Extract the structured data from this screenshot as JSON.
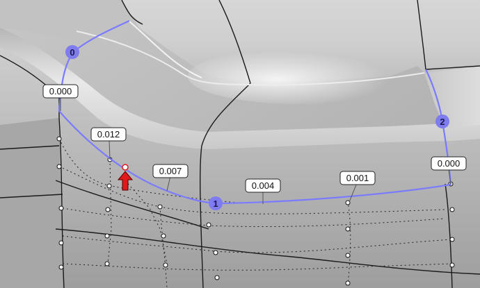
{
  "viewport": {
    "nodes": [
      {
        "label": "0"
      },
      {
        "label": "1"
      },
      {
        "label": "2"
      }
    ],
    "deviation_labels": [
      {
        "text": "0.000"
      },
      {
        "text": "0.012"
      },
      {
        "text": "0.007"
      },
      {
        "text": "0.004"
      },
      {
        "text": "0.001"
      },
      {
        "text": "0.000"
      }
    ],
    "colors": {
      "curve": "#7b7bff",
      "node": "#7f7cf0",
      "marker": "#e01a1a"
    }
  }
}
